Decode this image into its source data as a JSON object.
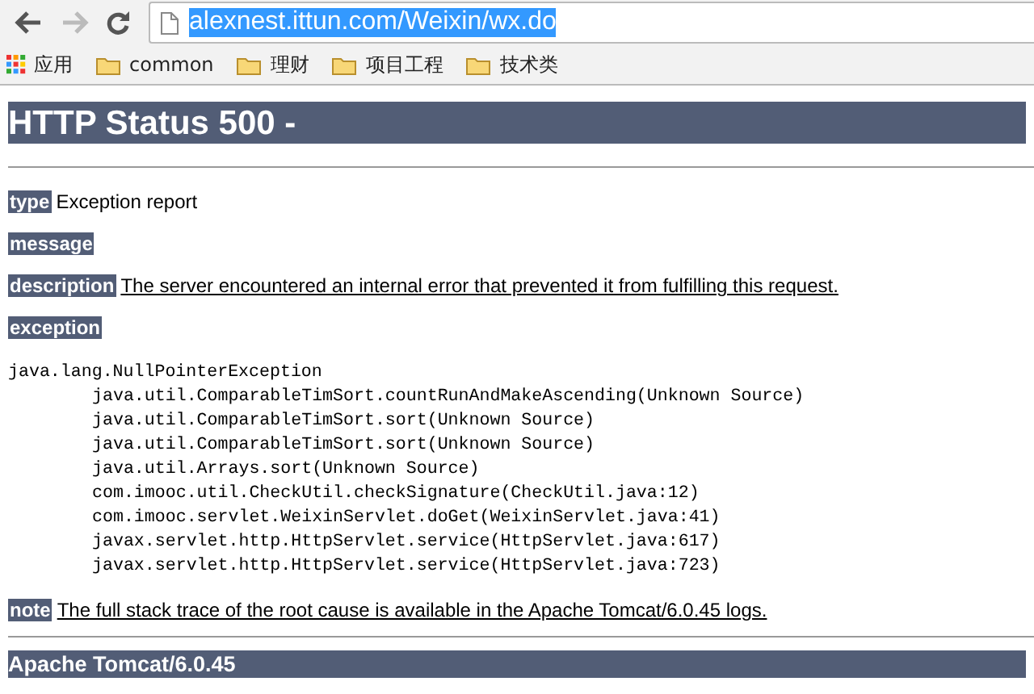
{
  "browser": {
    "url": "alexnest.ittun.com/Weixin/wx.do",
    "url_selected": true,
    "forward_disabled": true,
    "bookmarks": [
      {
        "label": "应用",
        "kind": "apps"
      },
      {
        "label": "common",
        "kind": "folder"
      },
      {
        "label": "理财",
        "kind": "folder"
      },
      {
        "label": "项目工程",
        "kind": "folder"
      },
      {
        "label": "技术类",
        "kind": "folder"
      }
    ]
  },
  "page": {
    "title": "HTTP Status 500 -",
    "sections": [
      {
        "label": "type",
        "text": "Exception report",
        "kind": "plain"
      },
      {
        "label": "message"
      },
      {
        "label": "description",
        "text": "The server encountered an internal error that prevented it from fulfilling this request.",
        "kind": "underlined"
      },
      {
        "label": "exception"
      }
    ],
    "stack_trace": {
      "exception": "java.lang.NullPointerException",
      "frames": [
        "java.util.ComparableTimSort.countRunAndMakeAscending(Unknown Source)",
        "java.util.ComparableTimSort.sort(Unknown Source)",
        "java.util.ComparableTimSort.sort(Unknown Source)",
        "java.util.Arrays.sort(Unknown Source)",
        "com.imooc.util.CheckUtil.checkSignature(CheckUtil.java:12)",
        "com.imooc.servlet.WeixinServlet.doGet(WeixinServlet.java:41)",
        "javax.servlet.http.HttpServlet.service(HttpServlet.java:617)",
        "javax.servlet.http.HttpServlet.service(HttpServlet.java:723)"
      ]
    },
    "note": {
      "label": "note",
      "text": "The full stack trace of the root cause is available in the Apache Tomcat/6.0.45 logs.",
      "kind": "underlined"
    },
    "footer": "Apache Tomcat/6.0.45"
  }
}
